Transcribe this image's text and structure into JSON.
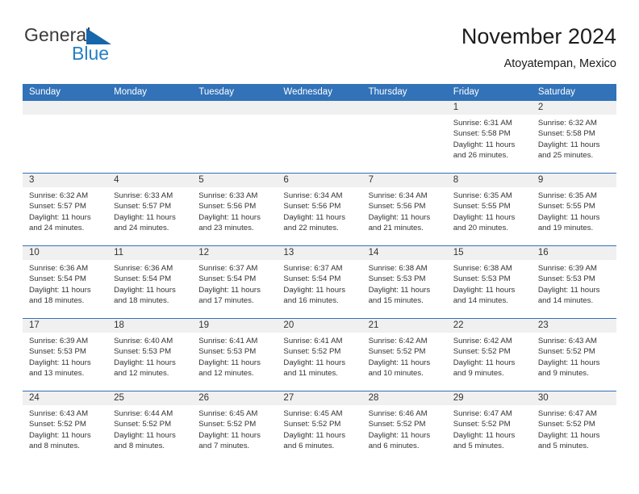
{
  "brand": {
    "name_top": "General",
    "name_bottom": "Blue",
    "triangle_color": "#1666ab",
    "top_color": "#3a3a3a",
    "bottom_color": "#2580c3"
  },
  "header": {
    "month_title": "November 2024",
    "location": "Atoyatempan, Mexico"
  },
  "calendar": {
    "accent_color": "#3272b8",
    "day_band_color": "#f0f0f0",
    "weekdays": [
      "Sunday",
      "Monday",
      "Tuesday",
      "Wednesday",
      "Thursday",
      "Friday",
      "Saturday"
    ],
    "weeks": [
      [
        {
          "day": "",
          "empty": true
        },
        {
          "day": "",
          "empty": true
        },
        {
          "day": "",
          "empty": true
        },
        {
          "day": "",
          "empty": true
        },
        {
          "day": "",
          "empty": true
        },
        {
          "day": "1",
          "sunrise": "Sunrise: 6:31 AM",
          "sunset": "Sunset: 5:58 PM",
          "daylight": "Daylight: 11 hours and 26 minutes."
        },
        {
          "day": "2",
          "sunrise": "Sunrise: 6:32 AM",
          "sunset": "Sunset: 5:58 PM",
          "daylight": "Daylight: 11 hours and 25 minutes."
        }
      ],
      [
        {
          "day": "3",
          "sunrise": "Sunrise: 6:32 AM",
          "sunset": "Sunset: 5:57 PM",
          "daylight": "Daylight: 11 hours and 24 minutes."
        },
        {
          "day": "4",
          "sunrise": "Sunrise: 6:33 AM",
          "sunset": "Sunset: 5:57 PM",
          "daylight": "Daylight: 11 hours and 24 minutes."
        },
        {
          "day": "5",
          "sunrise": "Sunrise: 6:33 AM",
          "sunset": "Sunset: 5:56 PM",
          "daylight": "Daylight: 11 hours and 23 minutes."
        },
        {
          "day": "6",
          "sunrise": "Sunrise: 6:34 AM",
          "sunset": "Sunset: 5:56 PM",
          "daylight": "Daylight: 11 hours and 22 minutes."
        },
        {
          "day": "7",
          "sunrise": "Sunrise: 6:34 AM",
          "sunset": "Sunset: 5:56 PM",
          "daylight": "Daylight: 11 hours and 21 minutes."
        },
        {
          "day": "8",
          "sunrise": "Sunrise: 6:35 AM",
          "sunset": "Sunset: 5:55 PM",
          "daylight": "Daylight: 11 hours and 20 minutes."
        },
        {
          "day": "9",
          "sunrise": "Sunrise: 6:35 AM",
          "sunset": "Sunset: 5:55 PM",
          "daylight": "Daylight: 11 hours and 19 minutes."
        }
      ],
      [
        {
          "day": "10",
          "sunrise": "Sunrise: 6:36 AM",
          "sunset": "Sunset: 5:54 PM",
          "daylight": "Daylight: 11 hours and 18 minutes."
        },
        {
          "day": "11",
          "sunrise": "Sunrise: 6:36 AM",
          "sunset": "Sunset: 5:54 PM",
          "daylight": "Daylight: 11 hours and 18 minutes."
        },
        {
          "day": "12",
          "sunrise": "Sunrise: 6:37 AM",
          "sunset": "Sunset: 5:54 PM",
          "daylight": "Daylight: 11 hours and 17 minutes."
        },
        {
          "day": "13",
          "sunrise": "Sunrise: 6:37 AM",
          "sunset": "Sunset: 5:54 PM",
          "daylight": "Daylight: 11 hours and 16 minutes."
        },
        {
          "day": "14",
          "sunrise": "Sunrise: 6:38 AM",
          "sunset": "Sunset: 5:53 PM",
          "daylight": "Daylight: 11 hours and 15 minutes."
        },
        {
          "day": "15",
          "sunrise": "Sunrise: 6:38 AM",
          "sunset": "Sunset: 5:53 PM",
          "daylight": "Daylight: 11 hours and 14 minutes."
        },
        {
          "day": "16",
          "sunrise": "Sunrise: 6:39 AM",
          "sunset": "Sunset: 5:53 PM",
          "daylight": "Daylight: 11 hours and 14 minutes."
        }
      ],
      [
        {
          "day": "17",
          "sunrise": "Sunrise: 6:39 AM",
          "sunset": "Sunset: 5:53 PM",
          "daylight": "Daylight: 11 hours and 13 minutes."
        },
        {
          "day": "18",
          "sunrise": "Sunrise: 6:40 AM",
          "sunset": "Sunset: 5:53 PM",
          "daylight": "Daylight: 11 hours and 12 minutes."
        },
        {
          "day": "19",
          "sunrise": "Sunrise: 6:41 AM",
          "sunset": "Sunset: 5:53 PM",
          "daylight": "Daylight: 11 hours and 12 minutes."
        },
        {
          "day": "20",
          "sunrise": "Sunrise: 6:41 AM",
          "sunset": "Sunset: 5:52 PM",
          "daylight": "Daylight: 11 hours and 11 minutes."
        },
        {
          "day": "21",
          "sunrise": "Sunrise: 6:42 AM",
          "sunset": "Sunset: 5:52 PM",
          "daylight": "Daylight: 11 hours and 10 minutes."
        },
        {
          "day": "22",
          "sunrise": "Sunrise: 6:42 AM",
          "sunset": "Sunset: 5:52 PM",
          "daylight": "Daylight: 11 hours and 9 minutes."
        },
        {
          "day": "23",
          "sunrise": "Sunrise: 6:43 AM",
          "sunset": "Sunset: 5:52 PM",
          "daylight": "Daylight: 11 hours and 9 minutes."
        }
      ],
      [
        {
          "day": "24",
          "sunrise": "Sunrise: 6:43 AM",
          "sunset": "Sunset: 5:52 PM",
          "daylight": "Daylight: 11 hours and 8 minutes."
        },
        {
          "day": "25",
          "sunrise": "Sunrise: 6:44 AM",
          "sunset": "Sunset: 5:52 PM",
          "daylight": "Daylight: 11 hours and 8 minutes."
        },
        {
          "day": "26",
          "sunrise": "Sunrise: 6:45 AM",
          "sunset": "Sunset: 5:52 PM",
          "daylight": "Daylight: 11 hours and 7 minutes."
        },
        {
          "day": "27",
          "sunrise": "Sunrise: 6:45 AM",
          "sunset": "Sunset: 5:52 PM",
          "daylight": "Daylight: 11 hours and 6 minutes."
        },
        {
          "day": "28",
          "sunrise": "Sunrise: 6:46 AM",
          "sunset": "Sunset: 5:52 PM",
          "daylight": "Daylight: 11 hours and 6 minutes."
        },
        {
          "day": "29",
          "sunrise": "Sunrise: 6:47 AM",
          "sunset": "Sunset: 5:52 PM",
          "daylight": "Daylight: 11 hours and 5 minutes."
        },
        {
          "day": "30",
          "sunrise": "Sunrise: 6:47 AM",
          "sunset": "Sunset: 5:52 PM",
          "daylight": "Daylight: 11 hours and 5 minutes."
        }
      ]
    ]
  }
}
